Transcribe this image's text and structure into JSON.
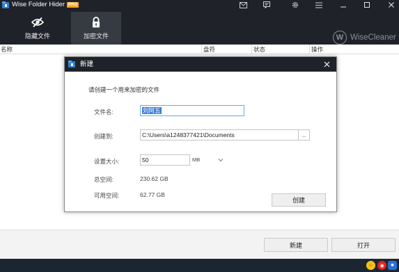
{
  "app": {
    "title": "Wise Folder Hider",
    "badge": "PRO"
  },
  "titlebar": {
    "icons": [
      "mail-icon",
      "feedback-icon",
      "settings-icon",
      "menu-icon",
      "minimize-icon",
      "maximize-icon",
      "close-icon"
    ]
  },
  "toolbar": {
    "tabs": [
      {
        "label": "隐藏文件",
        "icon": "eye-slash-icon"
      },
      {
        "label": "加密文件",
        "icon": "lock-icon"
      }
    ],
    "active_tab": 1,
    "brand_letter": "W",
    "brand_name": "WiseCleaner"
  },
  "table": {
    "columns": [
      "名称",
      "盘符",
      "状态",
      "操作"
    ]
  },
  "footer": {
    "new_label": "新建",
    "open_label": "打开"
  },
  "dialog": {
    "title": "新建",
    "prompt": "请创建一个用来加密的文件",
    "file_name_label": "文件名:",
    "file_name_value": "刘阿五",
    "create_in_label": "创建到:",
    "create_in_value": "C:\\Users\\a1248377421\\Documents",
    "browse_label": "...",
    "size_label": "设置大小:",
    "size_value": "50",
    "size_unit": "MB",
    "total_label": "总空间:",
    "total_value": "230.62 GB",
    "free_label": "可用空间:",
    "free_value": "62.77 GB",
    "create_label": "创建"
  },
  "colors": {
    "titlebar_bg": "#1f2329",
    "active_tab_bg": "#363b42",
    "selection": "#3b7fd6",
    "badge": "#f5a623"
  }
}
